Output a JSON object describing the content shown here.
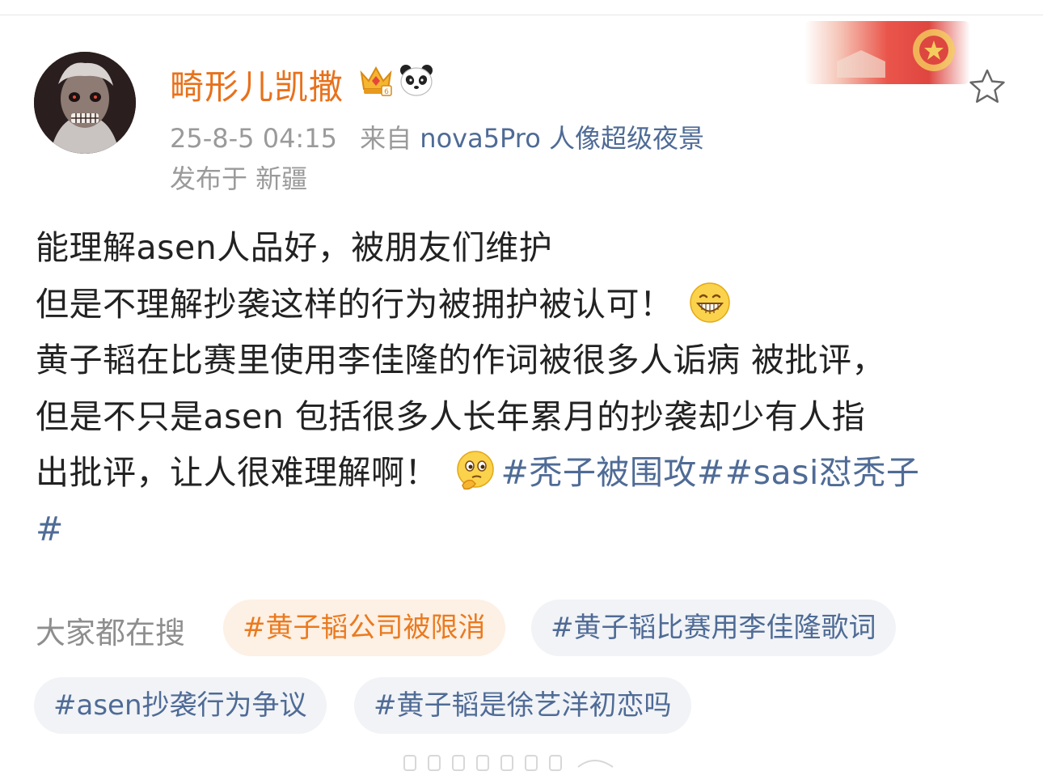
{
  "post": {
    "author": "畸形儿凯撒",
    "timestamp": "25-8-5 04:15",
    "source_prefix": "来自",
    "source_device": "nova5Pro 人像超级夜景",
    "location": "发布于 新疆",
    "icons": {
      "avatar": "avatar-image",
      "badge": "vip-crown-icon",
      "fan_badge": "panda-icon",
      "favorite": "star-outline-icon",
      "decor": "red-flag-banner",
      "emoji_grin": "grin-emoji",
      "emoji_think": "thinking-emoji"
    },
    "lines": [
      {
        "text": "能理解asen人品好，被朋友们维护"
      },
      {
        "text": "但是不理解抄袭这样的行为被拥护被认可！"
      },
      {
        "text": "黄子韬在比赛里使用李佳隆的作词被很多人诟病 被批评，"
      },
      {
        "text": "但是不只是asen 包括很多人长年累月的抄袭却少有人指"
      },
      {
        "text": "出批评，让人很难理解啊！"
      }
    ],
    "hashtag_1": "#秃子被围攻#",
    "hashtag_2a": "#sasi怼秃子",
    "hashtag_2b": "#"
  },
  "search": {
    "label": "大家都在搜",
    "chips": [
      {
        "text": "#黄子韬公司被限消",
        "hot": true
      },
      {
        "text": "#黄子韬比赛用李佳隆歌词",
        "hot": false
      },
      {
        "text": "#asen抄袭行为争议",
        "hot": false
      },
      {
        "text": "#黄子韬是徐艺洋初恋吗",
        "hot": false
      }
    ]
  },
  "colors": {
    "author": "#e8711b",
    "link": "#4f6b96",
    "hot_chip_bg": "#fdf0e4",
    "chip_bg": "#f1f3f6"
  }
}
